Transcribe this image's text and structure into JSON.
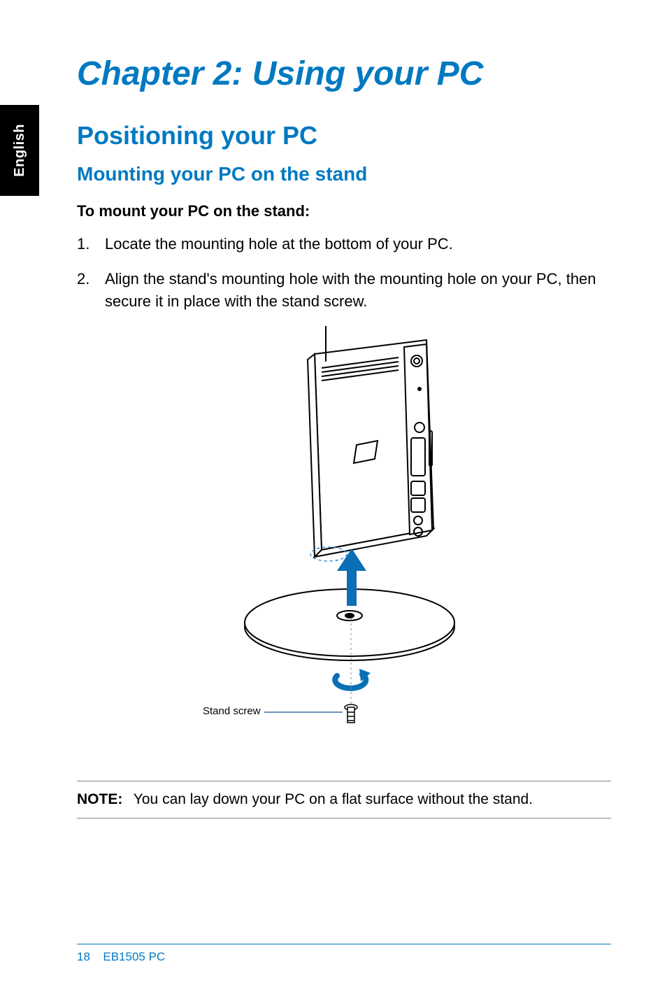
{
  "sideTab": {
    "language": "English"
  },
  "chapter": {
    "title": "Chapter 2: Using your PC"
  },
  "section": {
    "title": "Positioning your PC"
  },
  "subsection": {
    "title": "Mounting your PC on the stand"
  },
  "instructions": {
    "lead": "To mount your PC on the stand:",
    "steps": [
      {
        "num": "1.",
        "text": "Locate the mounting hole at the bottom of your PC."
      },
      {
        "num": "2.",
        "text": "Align the stand's mounting hole with the mounting hole on your PC, then secure it in place with the stand screw."
      }
    ]
  },
  "illustration": {
    "callouts": {
      "standScrew": "Stand screw"
    }
  },
  "note": {
    "label": "NOTE:",
    "text": "You can lay down your PC on a flat surface without the stand."
  },
  "footer": {
    "pageNumber": "18",
    "product": "EB1505 PC"
  }
}
